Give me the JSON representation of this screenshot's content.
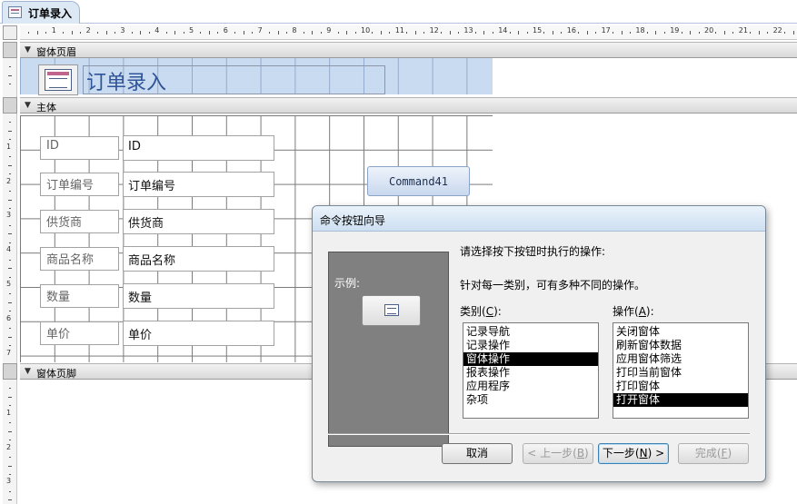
{
  "document_tab": {
    "label": "订单录入"
  },
  "sections": {
    "header": "窗体页眉",
    "detail": "主体",
    "footer": "窗体页脚"
  },
  "ruler": {
    "h_numbers": [
      "1",
      "2",
      "3",
      "4",
      "5",
      "6",
      "7",
      "8",
      "9",
      "10",
      "11",
      "12",
      "13",
      "14",
      "15",
      "16",
      "17",
      "18",
      "19",
      "20",
      "21",
      "22"
    ],
    "v_numbers": [
      "1",
      "2",
      "3",
      "4",
      "5",
      "6",
      "7",
      "1",
      "2",
      "3"
    ]
  },
  "form": {
    "title": "订单录入",
    "fields": [
      {
        "label": "ID",
        "value": "ID"
      },
      {
        "label": "订单编号",
        "value": "订单编号"
      },
      {
        "label": "供货商",
        "value": "供货商"
      },
      {
        "label": "商品名称",
        "value": "商品名称"
      },
      {
        "label": "数量",
        "value": "数量"
      },
      {
        "label": "单价",
        "value": "单价"
      }
    ],
    "command_button": "Command41"
  },
  "dialog": {
    "title": "命令按钮向导",
    "sample_label": "示例:",
    "instruction": "请选择按下按钮时执行的操作:",
    "hint": "针对每一类别，可有多种不同的操作。",
    "category_label": "类别",
    "category_key": "C",
    "action_label": "操作",
    "action_key": "A",
    "categories": [
      "记录导航",
      "记录操作",
      "窗体操作",
      "报表操作",
      "应用程序",
      "杂项"
    ],
    "selected_category": "窗体操作",
    "actions": [
      "关闭窗体",
      "刷新窗体数据",
      "应用窗体筛选",
      "打印当前窗体",
      "打印窗体",
      "打开窗体"
    ],
    "selected_action": "打开窗体",
    "buttons": {
      "cancel": "取消",
      "back": "< 上一步",
      "back_key": "B",
      "next": "下一步",
      "next_key": "N",
      "next_suffix": " >",
      "finish": "完成",
      "finish_key": "F"
    }
  }
}
